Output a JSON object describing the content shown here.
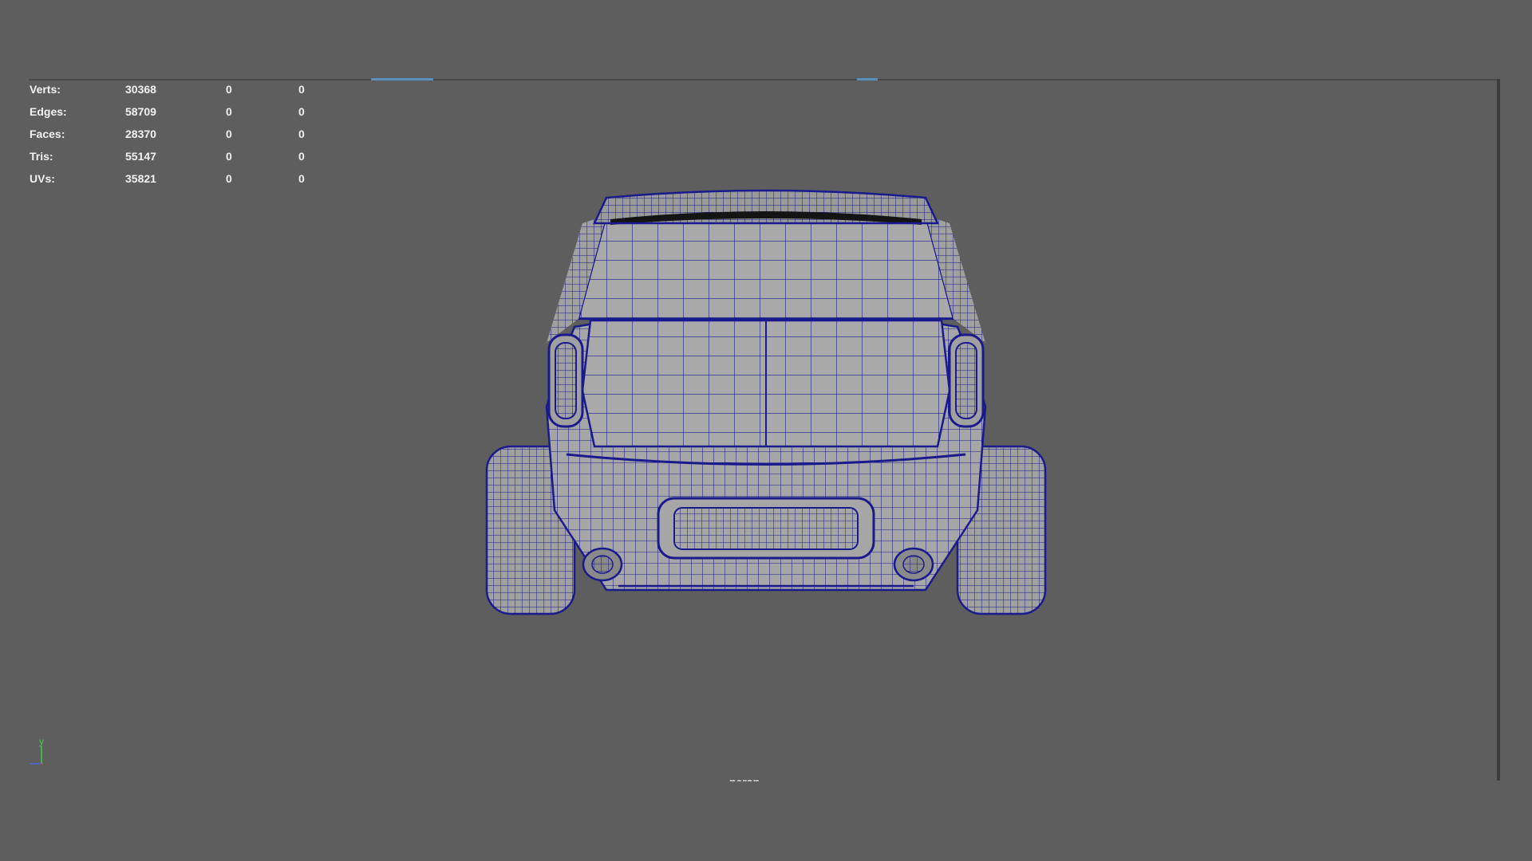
{
  "hud": {
    "rows": [
      {
        "label": "Verts:",
        "v1": "30368",
        "v2": "0",
        "v3": "0"
      },
      {
        "label": "Edges:",
        "v1": "58709",
        "v2": "0",
        "v3": "0"
      },
      {
        "label": "Faces:",
        "v1": "28370",
        "v2": "0",
        "v3": "0"
      },
      {
        "label": "Tris:",
        "v1": "55147",
        "v2": "0",
        "v3": "0"
      },
      {
        "label": "UVs:",
        "v1": "35821",
        "v2": "0",
        "v3": "0"
      }
    ]
  },
  "viewport": {
    "camera_label": "persp",
    "axis_label": "y"
  },
  "colors": {
    "background": "#5e5e5e",
    "wireframe": "#1a1a8c",
    "surface": "#a6a6a6",
    "hud_text": "#f2f2f2",
    "axis_y": "#3cd33c",
    "axis_x": "#d84a4a",
    "axis_z": "#4a6ad8"
  },
  "icons": {
    "axis_gizmo": "axis-gizmo-icon"
  }
}
